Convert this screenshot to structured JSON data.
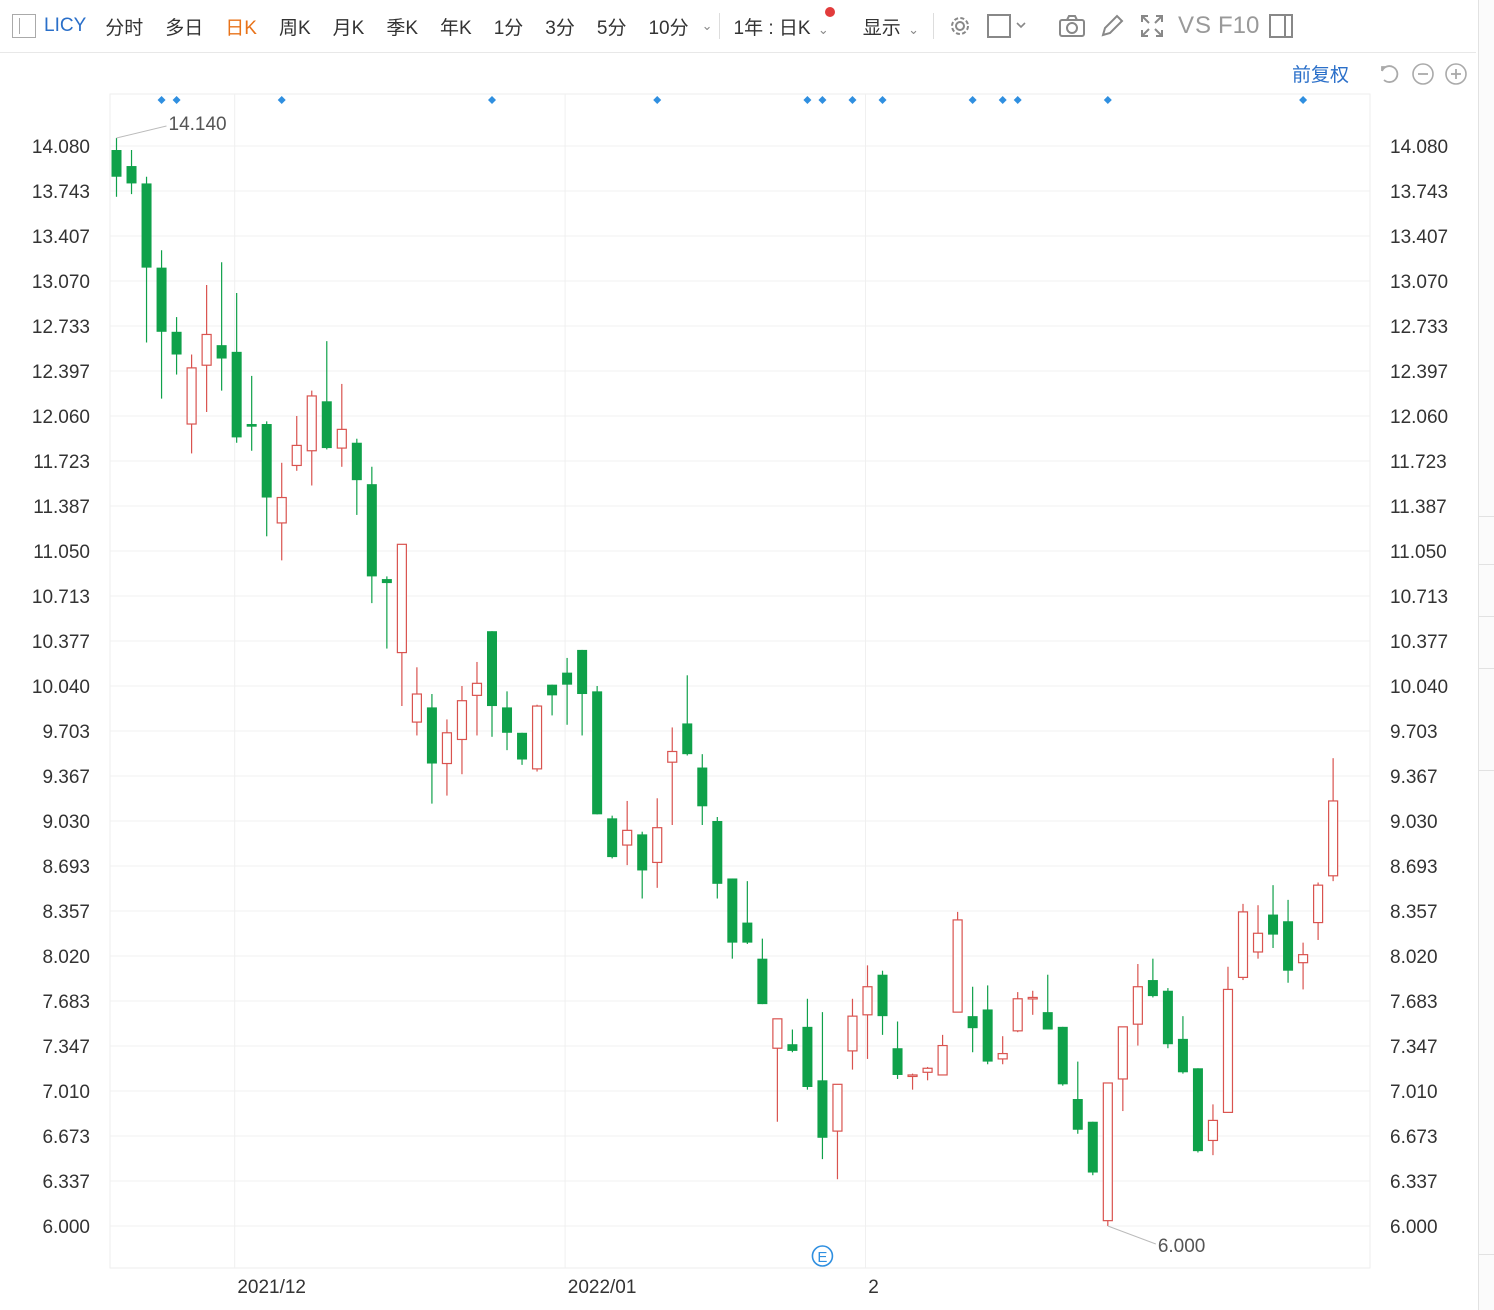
{
  "toolbar": {
    "symbol": "LICY",
    "tabs": [
      {
        "label": "分时",
        "active": false
      },
      {
        "label": "多日",
        "active": false
      },
      {
        "label": "日K",
        "active": true
      },
      {
        "label": "周K",
        "active": false
      },
      {
        "label": "月K",
        "active": false
      },
      {
        "label": "季K",
        "active": false
      },
      {
        "label": "年K",
        "active": false
      },
      {
        "label": "1分",
        "active": false
      },
      {
        "label": "3分",
        "active": false
      },
      {
        "label": "5分",
        "active": false
      },
      {
        "label": "10分",
        "active": false
      }
    ],
    "range_label": "1年 : 日K",
    "display_label": "显示",
    "vs_label": "VS",
    "f10_label": "F10",
    "fuquan_label": "前复权",
    "icons": [
      "layout-icon",
      "chevron-down-icon",
      "gear-icon",
      "square-icon",
      "camera-icon",
      "pencil-icon",
      "fullscreen-icon",
      "panel-icon",
      "undo-icon",
      "zoom-out-icon",
      "zoom-in-icon"
    ]
  },
  "colors": {
    "up": "#d9534f",
    "down": "#0fa14a",
    "accent": "#2a6fc9",
    "active": "#e8731a",
    "marker": "#2f8fe0"
  },
  "chart_data": {
    "type": "candlestick",
    "y_ticks": [
      "14.080",
      "13.743",
      "13.407",
      "13.070",
      "12.733",
      "12.397",
      "12.060",
      "11.723",
      "11.387",
      "11.050",
      "10.713",
      "10.377",
      "10.040",
      "9.703",
      "9.367",
      "9.030",
      "8.693",
      "8.357",
      "8.020",
      "7.683",
      "7.347",
      "7.010",
      "6.673",
      "6.337",
      "6.000"
    ],
    "ylim": [
      6.0,
      14.08
    ],
    "x_labels": [
      "2021/12",
      "2022/01",
      "2"
    ],
    "x_label_index": [
      8,
      30,
      50
    ],
    "high_label": "14.140",
    "low_label": "6.000",
    "event_marker": "E",
    "event_index": 47,
    "dividend_marker_index": [
      3,
      4,
      11,
      25,
      36,
      46,
      47,
      49,
      51,
      57,
      59,
      60,
      66,
      79
    ],
    "candles": [
      [
        14.05,
        13.85,
        14.14,
        13.7
      ],
      [
        13.93,
        13.8,
        14.05,
        13.72
      ],
      [
        13.8,
        13.17,
        13.85,
        12.61
      ],
      [
        13.17,
        12.69,
        13.3,
        12.19
      ],
      [
        12.69,
        12.52,
        12.8,
        12.37
      ],
      [
        12.0,
        12.42,
        12.52,
        11.78
      ],
      [
        12.44,
        12.67,
        13.04,
        12.09
      ],
      [
        12.59,
        12.49,
        13.21,
        12.25
      ],
      [
        12.54,
        11.9,
        12.98,
        11.86
      ],
      [
        12.0,
        11.98,
        12.36,
        11.8
      ],
      [
        12.0,
        11.45,
        12.02,
        11.16
      ],
      [
        11.26,
        11.45,
        11.71,
        10.98
      ],
      [
        11.69,
        11.84,
        12.06,
        11.65
      ],
      [
        11.8,
        12.21,
        12.25,
        11.54
      ],
      [
        12.17,
        11.82,
        12.62,
        11.81
      ],
      [
        11.82,
        11.96,
        12.3,
        11.68
      ],
      [
        11.86,
        11.58,
        11.89,
        11.32
      ],
      [
        11.55,
        10.86,
        11.68,
        10.66
      ],
      [
        10.84,
        10.81,
        10.86,
        10.32
      ],
      [
        10.29,
        11.1,
        11.1,
        9.89
      ],
      [
        9.77,
        9.98,
        10.18,
        9.67
      ],
      [
        9.88,
        9.46,
        9.98,
        9.16
      ],
      [
        9.46,
        9.69,
        9.79,
        9.22
      ],
      [
        9.64,
        9.93,
        10.04,
        9.38
      ],
      [
        9.97,
        10.06,
        10.22,
        9.67
      ],
      [
        10.45,
        9.89,
        10.45,
        9.66
      ],
      [
        9.88,
        9.69,
        10.0,
        9.56
      ],
      [
        9.69,
        9.49,
        9.69,
        9.45
      ],
      [
        9.42,
        9.89,
        9.9,
        9.4
      ],
      [
        10.05,
        9.97,
        10.05,
        9.82
      ],
      [
        10.14,
        10.05,
        10.25,
        9.75
      ],
      [
        10.31,
        9.98,
        10.31,
        9.67
      ],
      [
        10.0,
        9.08,
        10.04,
        9.08
      ],
      [
        9.05,
        8.76,
        9.07,
        8.75
      ],
      [
        8.85,
        8.96,
        9.18,
        8.7
      ],
      [
        8.93,
        8.66,
        8.95,
        8.45
      ],
      [
        8.72,
        8.98,
        9.2,
        8.53
      ],
      [
        9.47,
        9.55,
        9.73,
        9.0
      ],
      [
        9.76,
        9.53,
        10.12,
        9.52
      ],
      [
        9.43,
        9.14,
        9.53,
        9.0
      ],
      [
        9.03,
        8.56,
        9.06,
        8.45
      ],
      [
        8.6,
        8.12,
        8.6,
        8.0
      ],
      [
        8.27,
        8.12,
        8.58,
        8.11
      ],
      [
        8.0,
        7.66,
        8.15,
        7.66
      ],
      [
        7.33,
        7.55,
        7.55,
        6.78
      ],
      [
        7.36,
        7.31,
        7.47,
        7.3
      ],
      [
        7.49,
        7.04,
        7.7,
        7.02
      ],
      [
        7.09,
        6.66,
        7.6,
        6.5
      ],
      [
        6.71,
        7.06,
        7.06,
        6.35
      ],
      [
        7.31,
        7.57,
        7.7,
        7.17
      ],
      [
        7.58,
        7.79,
        7.95,
        7.25
      ],
      [
        7.88,
        7.57,
        7.91,
        7.43
      ],
      [
        7.33,
        7.13,
        7.53,
        7.1
      ],
      [
        7.13,
        7.13,
        7.14,
        7.02
      ],
      [
        7.15,
        7.18,
        7.19,
        7.09
      ],
      [
        7.13,
        7.35,
        7.43,
        7.14
      ],
      [
        7.6,
        8.29,
        8.35,
        7.6
      ],
      [
        7.57,
        7.48,
        7.79,
        7.3
      ],
      [
        7.62,
        7.23,
        7.8,
        7.21
      ],
      [
        7.25,
        7.29,
        7.42,
        7.21
      ],
      [
        7.46,
        7.7,
        7.75,
        7.45
      ],
      [
        7.71,
        7.71,
        7.76,
        7.58
      ],
      [
        7.6,
        7.47,
        7.88,
        7.47
      ],
      [
        7.49,
        7.06,
        7.49,
        7.05
      ],
      [
        6.95,
        6.72,
        7.23,
        6.69
      ],
      [
        6.78,
        6.4,
        6.78,
        6.38
      ],
      [
        6.04,
        7.07,
        7.07,
        6.0
      ],
      [
        7.1,
        7.49,
        7.49,
        6.86
      ],
      [
        7.51,
        7.79,
        7.96,
        7.35
      ],
      [
        7.84,
        7.72,
        8.0,
        7.71
      ],
      [
        7.76,
        7.36,
        7.78,
        7.33
      ],
      [
        7.4,
        7.15,
        7.57,
        7.14
      ],
      [
        7.18,
        6.56,
        7.18,
        6.55
      ],
      [
        6.64,
        6.79,
        6.91,
        6.53
      ],
      [
        6.85,
        7.77,
        7.94,
        6.85
      ],
      [
        7.86,
        8.35,
        8.41,
        7.84
      ],
      [
        8.05,
        8.19,
        8.4,
        8.0
      ],
      [
        8.33,
        8.18,
        8.55,
        8.08
      ],
      [
        8.28,
        7.91,
        8.44,
        7.82
      ],
      [
        7.97,
        8.03,
        8.12,
        7.77
      ],
      [
        8.27,
        8.55,
        8.57,
        8.14
      ],
      [
        8.62,
        9.18,
        9.5,
        8.58
      ]
    ]
  }
}
